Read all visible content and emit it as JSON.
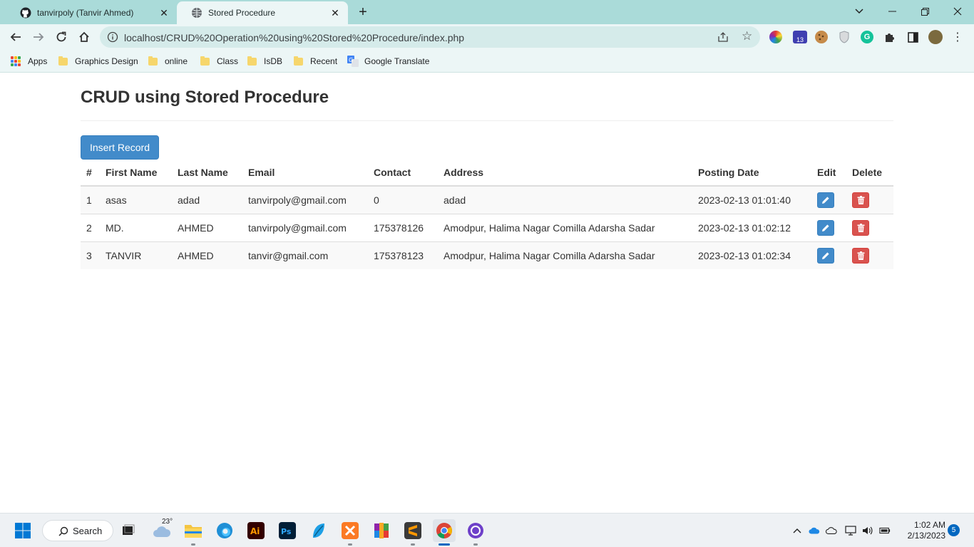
{
  "browser": {
    "tabs": [
      {
        "title": "tanvirpoly (Tanvir Ahmed)",
        "icon": "github-icon"
      },
      {
        "title": "Stored Procedure",
        "icon": "globe-icon"
      }
    ],
    "url": "localhost/CRUD%20Operation%20using%20Stored%20Procedure/index.php",
    "extension_badge": "13",
    "bookmarks": [
      {
        "label": "Apps",
        "icon": "apps-grid-icon"
      },
      {
        "label": "Graphics Design",
        "icon": "folder-icon"
      },
      {
        "label": "online",
        "icon": "folder-icon"
      },
      {
        "label": "Class",
        "icon": "folder-icon"
      },
      {
        "label": "IsDB",
        "icon": "folder-icon"
      },
      {
        "label": "Recent",
        "icon": "folder-icon"
      },
      {
        "label": "Google Translate",
        "icon": "google-translate-icon"
      }
    ]
  },
  "page": {
    "title": "CRUD using Stored Procedure",
    "insert_button": "Insert Record",
    "table": {
      "headers": [
        "#",
        "First Name",
        "Last Name",
        "Email",
        "Contact",
        "Address",
        "Posting Date",
        "Edit",
        "Delete"
      ],
      "rows": [
        {
          "num": "1",
          "first": "asas",
          "last": "adad",
          "email": "tanvirpoly@gmail.com",
          "contact": "0",
          "address": "adad",
          "date": "2023-02-13 01:01:40"
        },
        {
          "num": "2",
          "first": "MD.",
          "last": "AHMED",
          "email": "tanvirpoly@gmail.com",
          "contact": "175378126",
          "address": "Amodpur, Halima Nagar Comilla Adarsha Sadar",
          "date": "2023-02-13 01:02:12"
        },
        {
          "num": "3",
          "first": "TANVIR",
          "last": "AHMED",
          "email": "tanvir@gmail.com",
          "contact": "175378123",
          "address": "Amodpur, Halima Nagar Comilla Adarsha Sadar",
          "date": "2023-02-13 01:02:34"
        }
      ]
    }
  },
  "taskbar": {
    "search_label": "Search",
    "weather_temp": "23°",
    "time": "1:02 AM",
    "date": "2/13/2023",
    "notification_count": "5"
  },
  "colors": {
    "tab_strip": "#aadbd9",
    "toolbar": "#ecf6f6",
    "primary_button": "#428bca",
    "danger_button": "#d9534f"
  }
}
